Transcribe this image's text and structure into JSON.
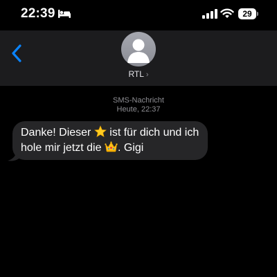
{
  "status": {
    "time": "22:39",
    "battery": "29",
    "icons": [
      "bed-icon",
      "signal-icon",
      "wifi-icon",
      "battery-icon"
    ]
  },
  "header": {
    "contact_name": "RTL",
    "chevron": "›",
    "icons": [
      "back-chevron-icon",
      "person-avatar-icon"
    ]
  },
  "conversation": {
    "type_label": "SMS-Nachricht",
    "timestamp": "Heute, 22:37",
    "message": {
      "part1": "Danke! Dieser ",
      "emoji1": "star",
      "part2": " ist für dich und ich hole mir jetzt die ",
      "emoji2": "crown",
      "part3": ". Gigi"
    }
  },
  "colors": {
    "accent": "#0a84ff",
    "header_bg": "#1c1c1e",
    "bubble_bg": "#262628",
    "meta_text": "#8e8e93"
  }
}
